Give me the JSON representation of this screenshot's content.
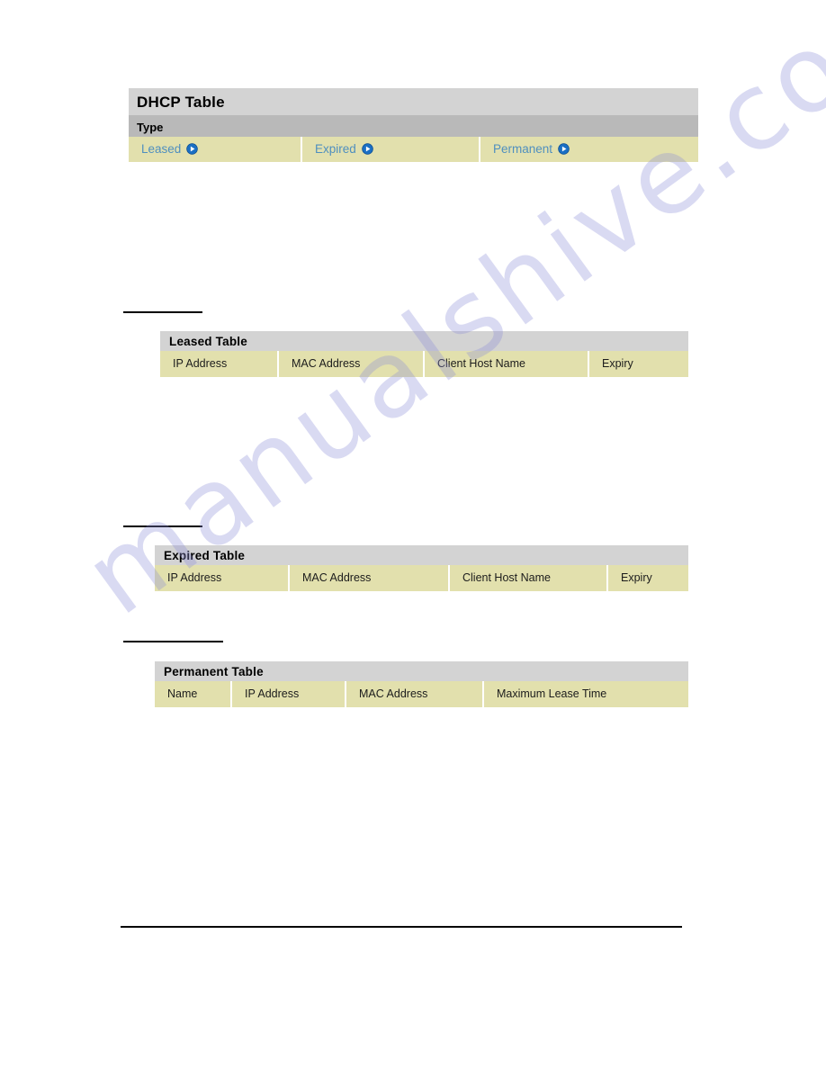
{
  "watermark": {
    "text": "manualshive.com"
  },
  "dhcp_panel": {
    "title": "DHCP Table",
    "subtitle": "Type",
    "types": [
      {
        "label": "Leased",
        "icon": "play-circle-icon"
      },
      {
        "label": "Expired",
        "icon": "play-circle-icon"
      },
      {
        "label": "Permanent",
        "icon": "play-circle-icon"
      }
    ]
  },
  "leased_panel": {
    "title": "Leased Table",
    "columns": [
      "IP Address",
      "MAC Address",
      "Client Host Name",
      "Expiry"
    ]
  },
  "expired_panel": {
    "title": "Expired Table",
    "columns": [
      "IP Address",
      "MAC Address",
      "Client Host Name",
      "Expiry"
    ]
  },
  "permanent_panel": {
    "title": "Permanent Table",
    "columns": [
      "Name",
      "IP Address",
      "MAC Address",
      "Maximum Lease Time"
    ]
  },
  "colors": {
    "panel_title_bg": "#d3d3d3",
    "panel_subtitle_bg": "#b9b9b9",
    "row_bg": "#e2e0ad",
    "link": "#4f8fbf",
    "icon_blue": "#1a6fc4",
    "watermark": "#8f90d8"
  }
}
